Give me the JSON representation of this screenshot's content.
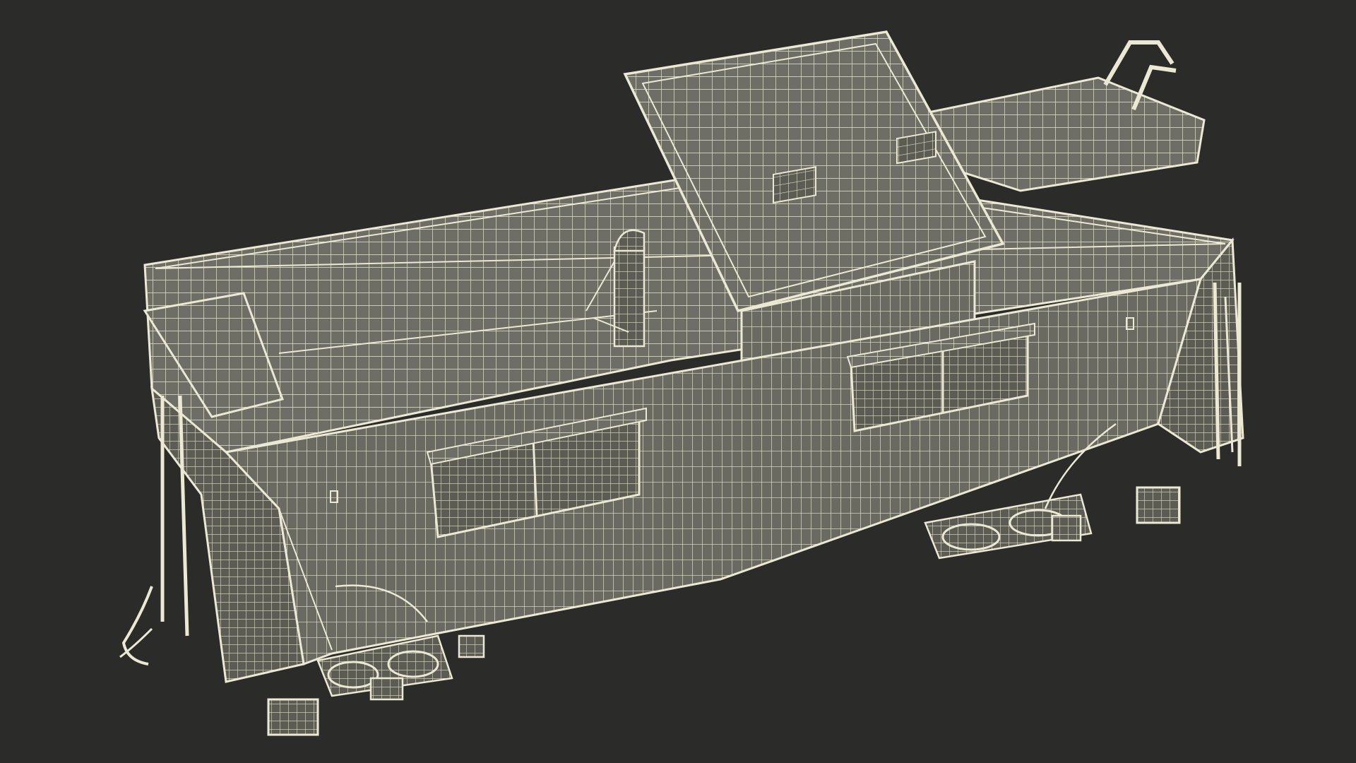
{
  "scene": {
    "subject": "caboose-wireframe-render",
    "colors": {
      "background": "#2b2b2a",
      "surface": "#6b6b63",
      "surface_light": "#7a7a71",
      "surface_dark": "#55554f",
      "wire": "#e8e6d2",
      "wire_dim": "#cfccb6"
    }
  }
}
